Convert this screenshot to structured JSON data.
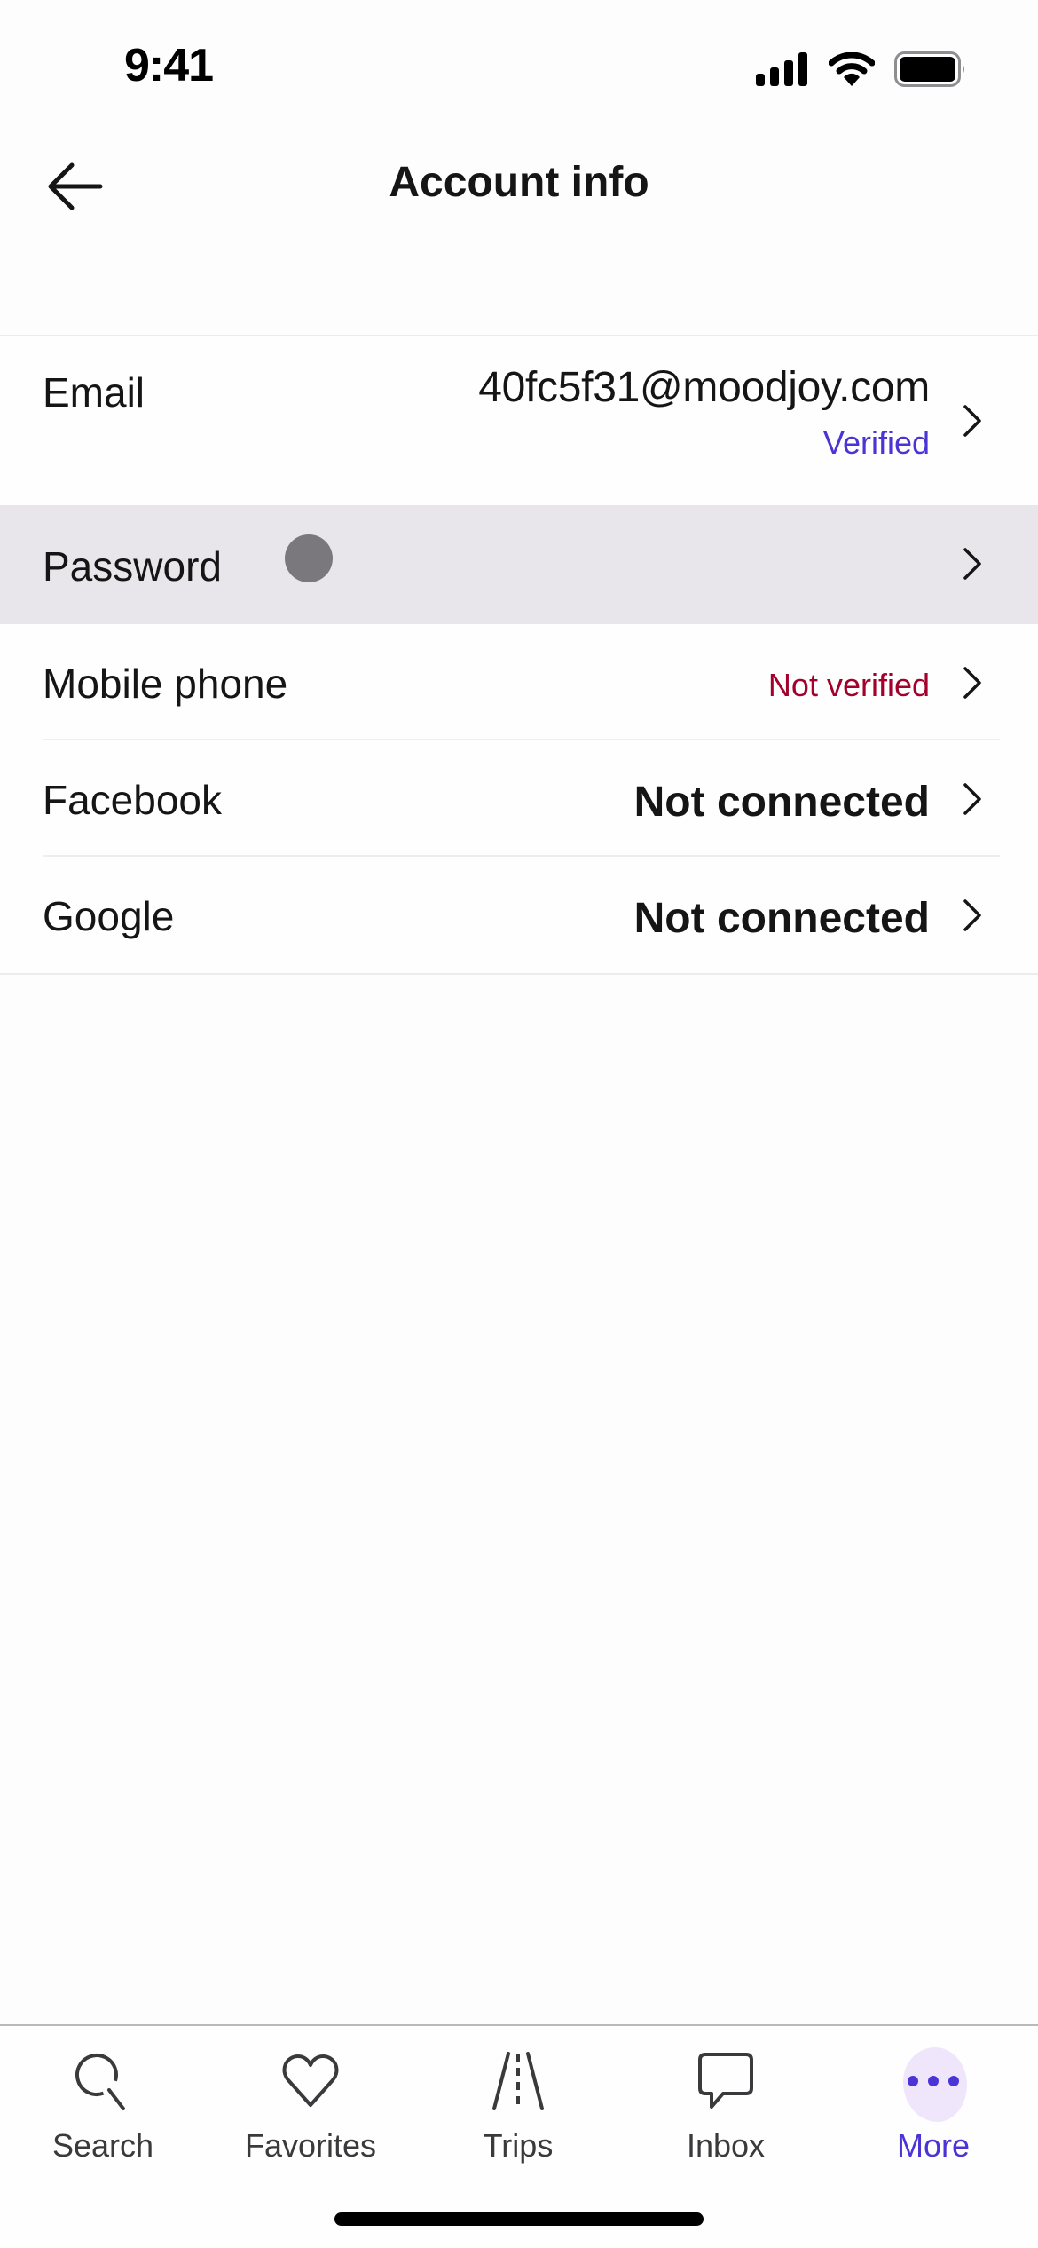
{
  "status_bar": {
    "time": "9:41",
    "icons": [
      "cellular-signal-icon",
      "wifi-icon",
      "battery-icon"
    ]
  },
  "header": {
    "back_icon": "arrow-left-icon",
    "title": "Account info"
  },
  "account_rows": [
    {
      "label": "Email",
      "value": "40fc5f31@moodjoy.com",
      "status": "Verified",
      "status_color": "#4b34d6"
    },
    {
      "label": "Password",
      "value": "",
      "pressed": true
    },
    {
      "label": "Mobile phone",
      "status": "Not verified",
      "status_color": "#a3002b"
    },
    {
      "label": "Facebook",
      "value": "Not connected"
    },
    {
      "label": "Google",
      "value": "Not connected"
    }
  ],
  "tab_bar": {
    "tabs": [
      {
        "label": "Search",
        "icon": "search-icon",
        "active": false
      },
      {
        "label": "Favorites",
        "icon": "heart-icon",
        "active": false
      },
      {
        "label": "Trips",
        "icon": "road-icon",
        "active": false
      },
      {
        "label": "Inbox",
        "icon": "chat-bubble-icon",
        "active": false
      },
      {
        "label": "More",
        "icon": "more-dots-icon",
        "active": true
      }
    ],
    "active_color": "#4b34d6",
    "inactive_color": "#3a3a3c"
  }
}
